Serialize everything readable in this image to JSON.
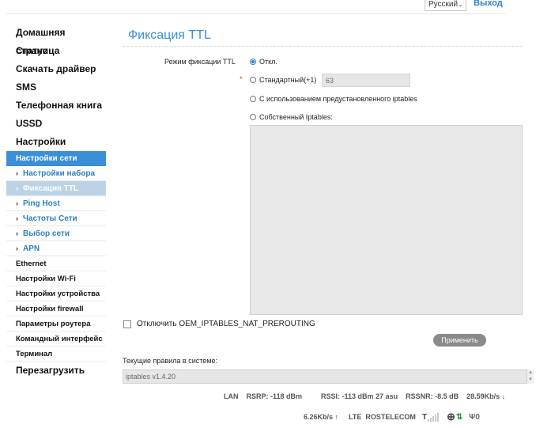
{
  "header": {
    "language": "Русский",
    "logout": "Выход"
  },
  "sidebar": {
    "main_items": [
      "Домашняя страница",
      "Статус",
      "Скачать драйвер",
      "SMS",
      "Телефонная книга",
      "USSD",
      "Настройки"
    ],
    "section_selected": "Настройки сети",
    "sub_items": [
      "Настройки набора",
      "Фиксация TTL",
      "Ping Host",
      "Частоты Сети",
      "Выбор сети",
      "APN"
    ],
    "active_sub_item": "Фиксация TTL",
    "small_items": [
      "Ethernet",
      "Настройки Wi-Fi",
      "Настройки устройства",
      "Настройки firewall",
      "Параметры роутера",
      "Командный интерфейс",
      "Терминал"
    ],
    "reboot": "Перезагрузить"
  },
  "page": {
    "title": "Фиксация TTL",
    "mode_label": "Режим фиксации TTL",
    "required_mark": "*",
    "options": {
      "off": "Откл.",
      "standard": "Стандартный(+1)",
      "preset": "С использованием предустановленного iptables",
      "custom": "Собственный Iptables:"
    },
    "selected_option": "off",
    "ttl_value": "63",
    "oem_checkbox": "Отключить OEM_IPTABLES_NAT_PREROUTING",
    "oem_checked": false,
    "apply_button": "Применить",
    "rules_label": "Текущие правила в системе:",
    "rules_value": "iptables v1.4.20"
  },
  "status": {
    "conn": "LAN",
    "rsrp": "RSRP: -118 dBm",
    "rssi": "RSSI: -113 dBm 27 asu",
    "rssnr": "RSSNR: -8.5 dB",
    "download": "28.59Kb/s ↓",
    "upload": "6.26Kb/s ↑",
    "network": "LTE",
    "operator": "ROSTELECOM",
    "signal_bars_lit": 0,
    "antenna_value": "0",
    "colors": {
      "accent": "#3a8fd6",
      "data_arrows": "#1a9a2e"
    }
  }
}
